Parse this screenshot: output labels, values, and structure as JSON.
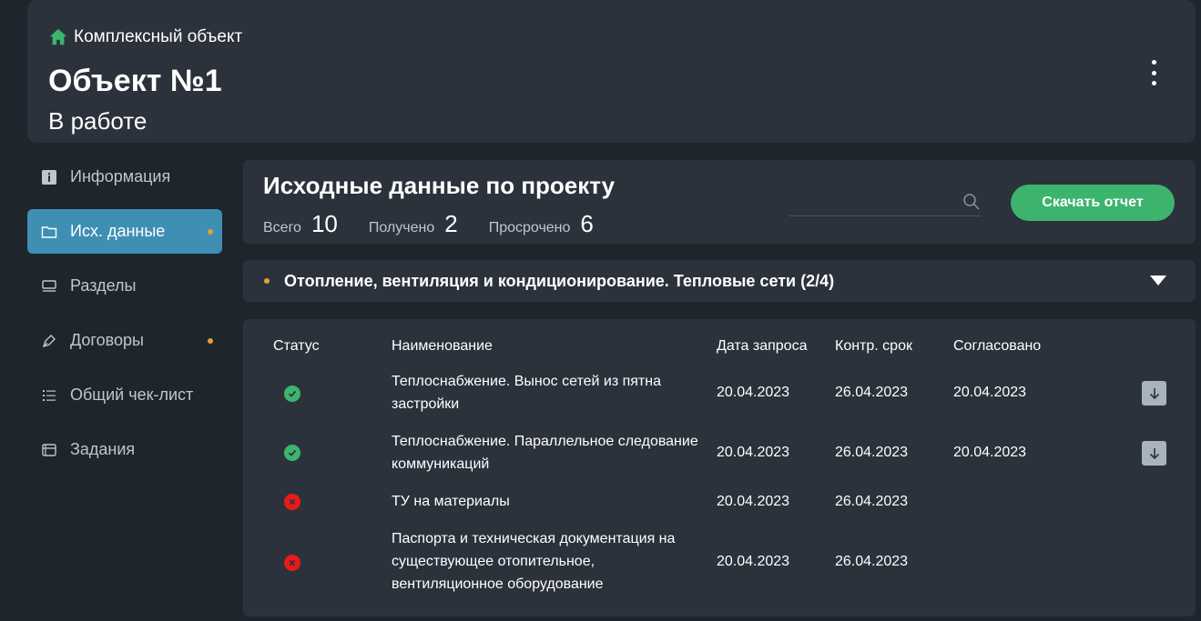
{
  "header": {
    "breadcrumb": "Комплексный объект",
    "title": "Объект №1",
    "status": "В работе"
  },
  "sidebar": {
    "items": [
      {
        "label": "Информация",
        "icon": "info-icon"
      },
      {
        "label": "Исх. данные",
        "icon": "folder-icon",
        "active": true,
        "dot": true
      },
      {
        "label": "Разделы",
        "icon": "sections-icon"
      },
      {
        "label": "Договоры",
        "icon": "pen-icon",
        "dot": true
      },
      {
        "label": "Общий чек-лист",
        "icon": "checklist-icon"
      },
      {
        "label": "Задания",
        "icon": "tasks-icon"
      }
    ]
  },
  "panel": {
    "title": "Исходные данные по проекту",
    "stats": {
      "total_label": "Всего",
      "total_value": "10",
      "received_label": "Получено",
      "received_value": "2",
      "overdue_label": "Просрочено",
      "overdue_value": "6"
    },
    "search_placeholder": "",
    "download_label": "Скачать отчет"
  },
  "section": {
    "title": "Отопление, вентиляция и кондиционирование. Тепловые сети (2/4)"
  },
  "table": {
    "headers": {
      "status": "Статус",
      "name": "Наименование",
      "request_date": "Дата запроса",
      "deadline": "Контр. срок",
      "approved": "Согласовано"
    },
    "rows": [
      {
        "status": "ok",
        "name_lines": [
          "Теплоснабжение. Вынос сетей из пятна",
          "застройки"
        ],
        "request_date": "20.04.2023",
        "deadline": "26.04.2023",
        "approved": "20.04.2023",
        "download": true
      },
      {
        "status": "ok",
        "name_lines": [
          "Теплоснабжение. Параллельное следование",
          "коммуникаций"
        ],
        "request_date": "20.04.2023",
        "deadline": "26.04.2023",
        "approved": "20.04.2023",
        "download": true
      },
      {
        "status": "bad",
        "name_lines": [
          "ТУ на материалы"
        ],
        "request_date": "20.04.2023",
        "deadline": "26.04.2023",
        "approved": "",
        "download": false
      },
      {
        "status": "bad",
        "name_lines": [
          "Паспорта и техническая документация на",
          "существующее отопительное,",
          "вентиляционное оборудование"
        ],
        "request_date": "20.04.2023",
        "deadline": "26.04.2023",
        "approved": "",
        "download": false
      }
    ]
  },
  "colors": {
    "accent_green": "#3db46d",
    "active_blue": "#3f8fb4",
    "dot_orange": "#e8a030",
    "error_red": "#e81a1a"
  }
}
